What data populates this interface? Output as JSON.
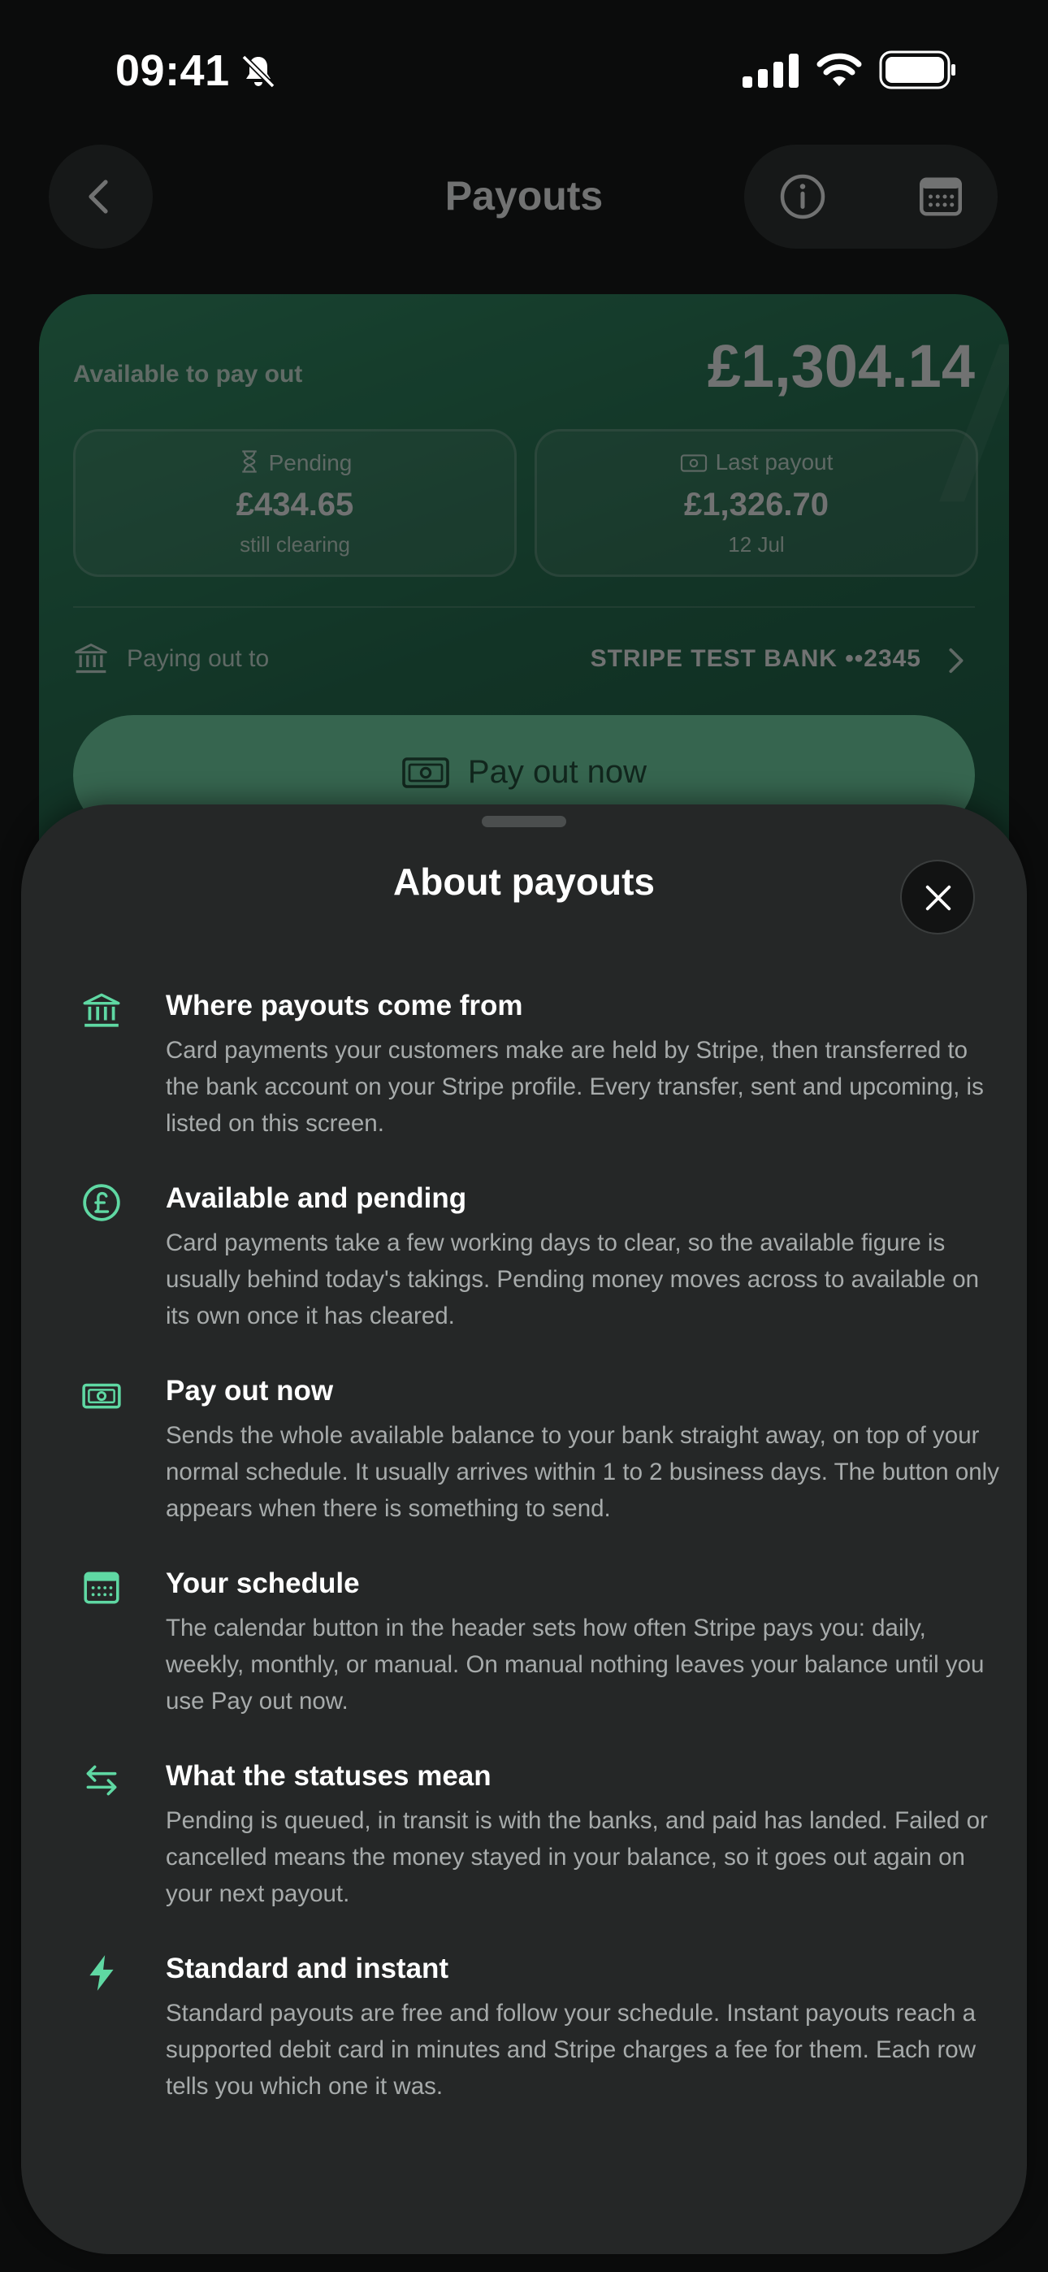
{
  "status_bar": {
    "time": "09:41",
    "icons": [
      "bell-slash-icon",
      "cellular-signal-icon",
      "wifi-icon",
      "battery-icon"
    ]
  },
  "header": {
    "title": "Payouts",
    "icons": [
      "chevron-left-icon",
      "info-icon",
      "calendar-icon"
    ]
  },
  "balance_card": {
    "available_label": "Available to pay out",
    "available_amount": "£1,304.14",
    "pending": {
      "label": "Pending",
      "amount": "£434.65",
      "sub": "still clearing",
      "icon": "hourglass-icon"
    },
    "last_payout": {
      "label": "Last payout",
      "amount": "£1,326.70",
      "sub": "12 Jul",
      "icon": "banknote-icon"
    },
    "paying_out_label": "Paying out to",
    "bank": "STRIPE TEST BANK ••2345",
    "pay_out_button": "Pay out now"
  },
  "sheet": {
    "title": "About payouts",
    "items": [
      {
        "icon": "bank-icon",
        "title": "Where payouts come from",
        "body": "Card payments your customers make are held by Stripe, then transferred to the bank account on your Stripe profile. Every transfer, sent and upcoming, is listed on this screen."
      },
      {
        "icon": "pound-circle-icon",
        "title": "Available and pending",
        "body": "Card payments take a few working days to clear, so the available figure is usually behind today's takings. Pending money moves across to available on its own once it has cleared."
      },
      {
        "icon": "banknote-icon",
        "title": "Pay out now",
        "body": "Sends the whole available balance to your bank straight away, on top of your normal schedule. It usually arrives within 1 to 2 business days. The button only appears when there is something to send."
      },
      {
        "icon": "calendar-icon",
        "title": "Your schedule",
        "body": "The calendar button in the header sets how often Stripe pays you: daily, weekly, monthly, or manual. On manual nothing leaves your balance until you use Pay out now."
      },
      {
        "icon": "arrows-exchange-icon",
        "title": "What the statuses mean",
        "body": "Pending is queued, in transit is with the banks, and paid has landed. Failed or cancelled means the money stayed in your balance, so it goes out again on your next payout."
      },
      {
        "icon": "lightning-icon",
        "title": "Standard and instant",
        "body": "Standard payouts are free and follow your schedule. Instant payouts reach a supported debit card in minutes and Stripe charges a fee for them. Each row tells you which one it was."
      }
    ]
  },
  "colors": {
    "accent": "#5fd8a3",
    "card_green": "#1f7a53",
    "sheet_bg": "#252727",
    "body_text": "#a7abab"
  }
}
